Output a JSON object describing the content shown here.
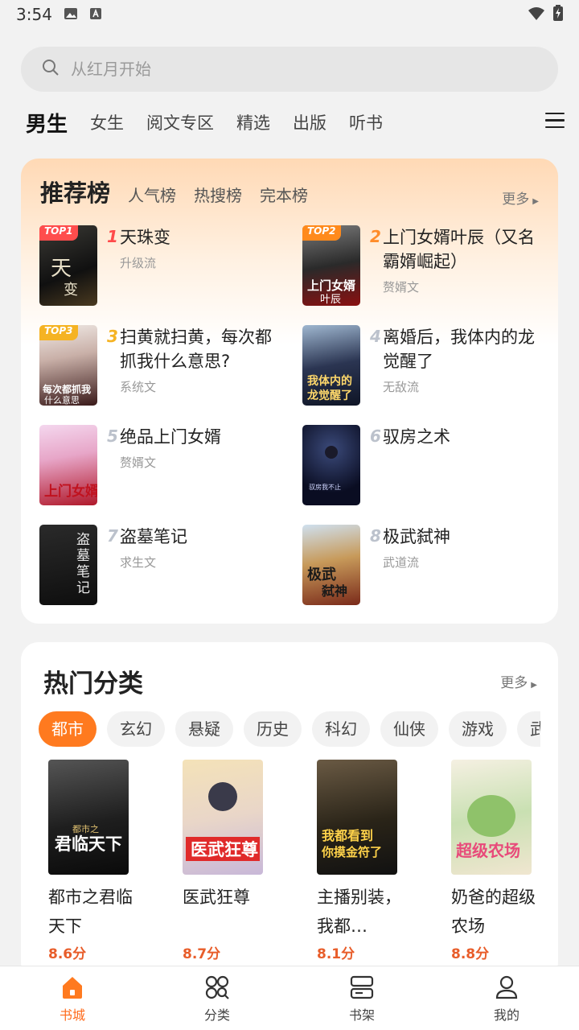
{
  "status_bar": {
    "time": "3:54"
  },
  "search": {
    "placeholder": "从红月开始"
  },
  "tabs": [
    {
      "label": "男生",
      "active": true
    },
    {
      "label": "女生"
    },
    {
      "label": "阅文专区"
    },
    {
      "label": "精选"
    },
    {
      "label": "出版"
    },
    {
      "label": "听书"
    }
  ],
  "ranking": {
    "title": "推荐榜",
    "tabs": [
      "人气榜",
      "热搜榜",
      "完本榜"
    ],
    "more": "更多",
    "items": [
      {
        "rank": "1",
        "tag": "TOP1",
        "name": "天珠变",
        "genre": "升级流"
      },
      {
        "rank": "2",
        "tag": "TOP2",
        "name": "上门女婿叶辰（又名霸婿崛起）",
        "genre": "赘婿文"
      },
      {
        "rank": "3",
        "tag": "TOP3",
        "name": "扫黄就扫黄，每次都抓我什么意思?",
        "genre": "系统文"
      },
      {
        "rank": "4",
        "tag": "",
        "name": "离婚后，我体内的龙觉醒了",
        "genre": "无敌流"
      },
      {
        "rank": "5",
        "tag": "",
        "name": "绝品上门女婿",
        "genre": "赘婿文"
      },
      {
        "rank": "6",
        "tag": "",
        "name": "驭房之术",
        "genre": ""
      },
      {
        "rank": "7",
        "tag": "",
        "name": "盗墓笔记",
        "genre": "求生文"
      },
      {
        "rank": "8",
        "tag": "",
        "name": "极武弑神",
        "genre": "武道流"
      }
    ]
  },
  "hot": {
    "title": "热门分类",
    "more": "更多",
    "chips": [
      "都市",
      "玄幻",
      "悬疑",
      "历史",
      "科幻",
      "仙侠",
      "游戏",
      "武侠"
    ],
    "books": [
      {
        "title": "都市之君临天下",
        "score": "8.6分"
      },
      {
        "title": "医武狂尊",
        "score": "8.7分"
      },
      {
        "title": "主播别装，我都…",
        "score": "8.1分"
      },
      {
        "title": "奶爸的超级农场",
        "score": "8.8分"
      }
    ]
  },
  "nav": [
    {
      "label": "书城",
      "icon": "home-icon",
      "active": true
    },
    {
      "label": "分类",
      "icon": "category-icon"
    },
    {
      "label": "书架",
      "icon": "bookshelf-icon"
    },
    {
      "label": "我的",
      "icon": "profile-icon"
    }
  ],
  "colors": {
    "accent": "#ff7a1f",
    "rank_gradient_top": "#ffd9b5",
    "score": "#e85d2a"
  }
}
